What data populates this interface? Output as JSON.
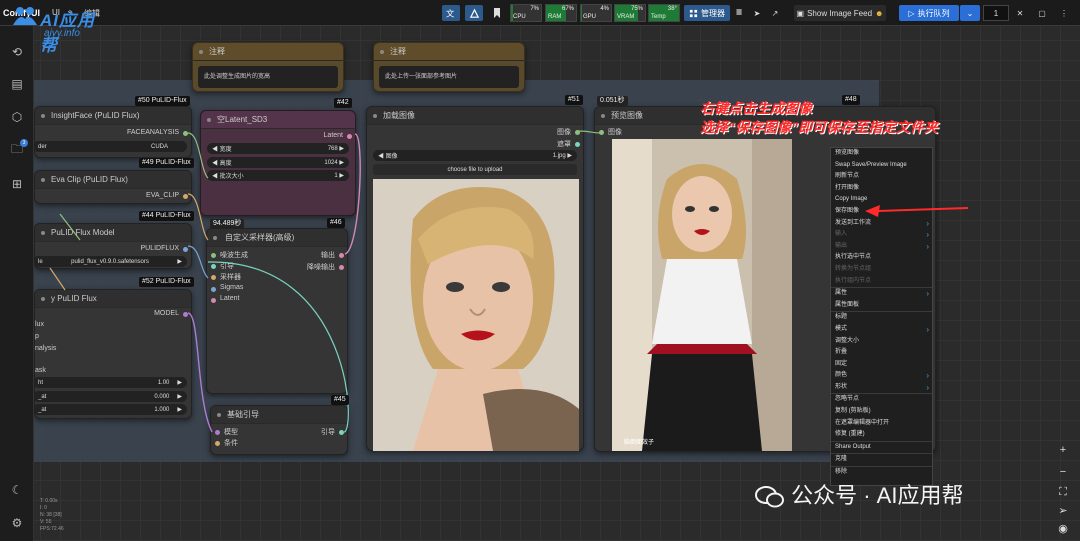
{
  "app": {
    "title": "ComfyUI"
  },
  "logo": {
    "main": "AI应用帮",
    "sub": "aiyy.info"
  },
  "menu": [
    "Com",
    "UI",
    "s",
    "编辑"
  ],
  "topbar": {
    "manager_label": "管理器",
    "show_feed_label": "Show Image Feed",
    "run_label": "执行队列",
    "queue_count": "1",
    "meters": [
      {
        "label": "CPU",
        "value": "7%",
        "fraction": 0.07
      },
      {
        "label": "RAM",
        "value": "67%",
        "fraction": 0.67
      },
      {
        "label": "GPU",
        "value": "4%",
        "fraction": 0.04
      },
      {
        "label": "VRAM",
        "value": "75%",
        "fraction": 0.75
      },
      {
        "label": "Temp",
        "value": "38°",
        "fraction": 1.0
      }
    ]
  },
  "sidebar": {
    "badge": "3",
    "stats": [
      "T: 0.00s",
      "I: 0",
      "N: 38 [38]",
      "V: 55",
      "FPS:72.46"
    ]
  },
  "notes": [
    {
      "title": "注释",
      "text": "此处调整生成图片的宽高"
    },
    {
      "title": "注释",
      "text": "此处上传一张面部参考图片"
    }
  ],
  "nodes": {
    "insightface": {
      "badge": "#50 PuLID-Flux",
      "title": "InsightFace (PuLID Flux)",
      "output": "FACEANALYSIS",
      "widget_left": "der",
      "widget_value": "CUDA"
    },
    "evaclip": {
      "badge": "#49 PuLID-Flux",
      "title": "Eva Clip (PuLID Flux)",
      "output": "EVA_CLIP"
    },
    "pulidmodel": {
      "badge": "#44 PuLID-Flux",
      "title": "PuLID Flux Model",
      "output": "PULIDFLUX",
      "widget_left": "le",
      "widget_value": "pulid_flux_v0.9.0.safetensors"
    },
    "applypulid": {
      "badge": "#52 PuLID-Flux",
      "title": "y PuLID Flux",
      "output": "MODEL",
      "inputs": [
        "lux",
        "p",
        "nalysis",
        "ask"
      ],
      "widgets": [
        {
          "label": "ht",
          "value": "1.00"
        },
        {
          "label": "_at",
          "value": "0.000"
        },
        {
          "label": "_at",
          "value": "1.000"
        }
      ]
    },
    "latent": {
      "badge": "#42",
      "title": "空Latent_SD3",
      "output": "Latent",
      "widgets": [
        {
          "label": "宽度",
          "value": "768"
        },
        {
          "label": "高度",
          "value": "1024"
        },
        {
          "label": "批次大小",
          "value": "1"
        }
      ],
      "time": "94.489秒"
    },
    "sampler": {
      "badge": "#46",
      "title": "自定义采样器(高级)",
      "inputs": [
        "噪波生成",
        "引导",
        "采样器",
        "Sigmas",
        "Latent"
      ],
      "outputs": [
        "输出",
        "降噪输出"
      ]
    },
    "guider": {
      "badge": "#45",
      "title": "基础引导",
      "inputs": [
        "模型",
        "条件"
      ],
      "output": "引导"
    },
    "loadimage": {
      "badge": "#51",
      "title": "加载图像",
      "outputs": [
        "图像",
        "遮罩"
      ],
      "widget_label": "图像",
      "widget_value": "1.jpg",
      "upload_label": "choose file to upload"
    },
    "preview": {
      "badge": "#48",
      "time": "0.051秒",
      "title": "预览图像",
      "input": "图像",
      "watermark": "脑倒面效子"
    }
  },
  "context_menu": {
    "items": [
      {
        "label": "预览图像",
        "dim": false,
        "arrow": false
      },
      {
        "label": "Swap Save/Preview Image",
        "dim": false,
        "arrow": false
      },
      {
        "label": "刷新节点",
        "dim": false,
        "arrow": false
      },
      {
        "label": "打开图像",
        "dim": false,
        "arrow": false
      },
      {
        "label": "Copy Image",
        "dim": false,
        "arrow": false
      },
      {
        "label": "保存图像",
        "dim": false,
        "arrow": false
      },
      {
        "label": "发送到工作流",
        "dim": false,
        "arrow": true
      },
      {
        "label": "输入",
        "dim": true,
        "arrow": true
      },
      {
        "label": "输出",
        "dim": true,
        "arrow": true
      },
      {
        "label": "执行选中节点",
        "dim": false,
        "arrow": false
      },
      {
        "label": "转换为节点组",
        "dim": true,
        "arrow": false
      },
      {
        "label": "执行组内节点",
        "dim": true,
        "arrow": false
      },
      {
        "sep": true
      },
      {
        "label": "属性",
        "dim": false,
        "arrow": true
      },
      {
        "label": "属性面板",
        "dim": false,
        "arrow": false
      },
      {
        "sep": true
      },
      {
        "label": "标题",
        "dim": false,
        "arrow": false
      },
      {
        "label": "模式",
        "dim": false,
        "arrow": true
      },
      {
        "label": "调整大小",
        "dim": false,
        "arrow": false
      },
      {
        "label": "折叠",
        "dim": false,
        "arrow": false
      },
      {
        "label": "固定",
        "dim": false,
        "arrow": false
      },
      {
        "label": "颜色",
        "dim": false,
        "arrow": true
      },
      {
        "label": "形状",
        "dim": false,
        "arrow": true
      },
      {
        "sep": true
      },
      {
        "label": "忽略节点",
        "dim": false,
        "arrow": false
      },
      {
        "label": "复制 (剪贴板)",
        "dim": false,
        "arrow": false
      },
      {
        "label": "在遮罩编辑器中打开",
        "dim": false,
        "arrow": false
      },
      {
        "label": "修复 (重建)",
        "dim": false,
        "arrow": false
      },
      {
        "sep": true
      },
      {
        "label": "Share Output",
        "dim": false,
        "arrow": false
      },
      {
        "sep": true
      },
      {
        "label": "克隆",
        "dim": false,
        "arrow": false
      },
      {
        "sep": true
      },
      {
        "label": "移除",
        "dim": false,
        "arrow": false
      }
    ]
  },
  "annotation": {
    "line1": "右键点击生成图像",
    "line2": "选择“保存图像”即可保存至指定文件夹"
  },
  "watermark": {
    "text": "公众号 · AI应用帮"
  },
  "colors": {
    "accent": "#2d5a8c",
    "annotation": "#ff2a2a",
    "meter_fill": "#1e7b35"
  }
}
